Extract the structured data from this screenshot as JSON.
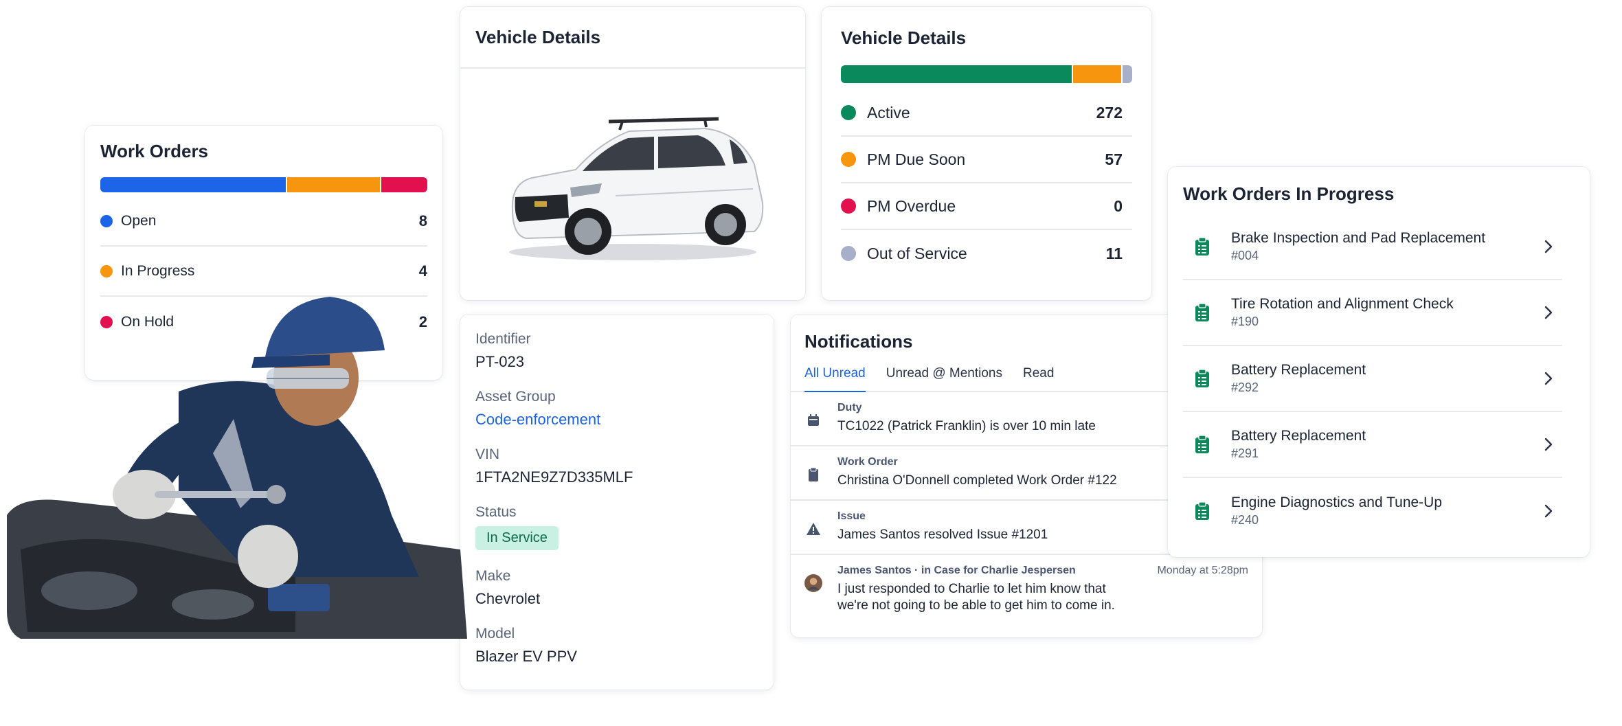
{
  "work_orders": {
    "title": "Work Orders",
    "bar": [
      {
        "value": 8,
        "color": "#1c64e8"
      },
      {
        "value": 4,
        "color": "#f7950f"
      },
      {
        "value": 2,
        "color": "#e2104f"
      }
    ],
    "items": [
      {
        "label": "Open",
        "count": "8",
        "color": "#1c64e8"
      },
      {
        "label": "In Progress",
        "count": "4",
        "color": "#f7950f"
      },
      {
        "label": "On Hold",
        "count": "2",
        "color": "#e2104f"
      }
    ]
  },
  "vehicle_photo": {
    "title": "Vehicle Details"
  },
  "vehicle_stats": {
    "title": "Vehicle Details",
    "bar": [
      {
        "value": 272,
        "color": "#0a8a5c"
      },
      {
        "value": 57,
        "color": "#f7950f"
      },
      {
        "value": 0,
        "color": "#e2104f"
      },
      {
        "value": 11,
        "color": "#a7b0c8"
      }
    ],
    "items": [
      {
        "label": "Active",
        "count": "272",
        "color": "#0a8a5c"
      },
      {
        "label": "PM Due Soon",
        "count": "57",
        "color": "#f7950f"
      },
      {
        "label": "PM Overdue",
        "count": "0",
        "color": "#e2104f"
      },
      {
        "label": "Out of Service",
        "count": "11",
        "color": "#a7b0c8"
      }
    ]
  },
  "details": {
    "identifier_label": "Identifier",
    "identifier": "PT-023",
    "asset_group_label": "Asset Group",
    "asset_group": "Code-enforcement",
    "vin_label": "VIN",
    "vin": "1FTA2NE9Z7D335MLF",
    "status_label": "Status",
    "status": "In Service",
    "make_label": "Make",
    "make": "Chevrolet",
    "model_label": "Model",
    "model": "Blazer EV PPV"
  },
  "notifications": {
    "title": "Notifications",
    "tabs": [
      "All Unread",
      "Unread @ Mentions",
      "Read"
    ],
    "items": [
      {
        "icon": "calendar-icon",
        "category": "Duty",
        "text": "TC1022 (Patrick Franklin) is over 10 min late",
        "time": "Mo"
      },
      {
        "icon": "clipboard-icon",
        "category": "Work Order",
        "text": "Christina O'Donnell completed Work Order #122",
        "time": "M"
      },
      {
        "icon": "warning-icon",
        "category": "Issue",
        "text": "James Santos resolved Issue #1201",
        "time": "M"
      },
      {
        "icon": "avatar",
        "category": "James Santos · in Case for Charlie Jespersen",
        "text": "I just responded to Charlie to let him know that we're not going to be able to get him to come in.",
        "time": "Monday at 5:28pm"
      }
    ]
  },
  "in_progress": {
    "title": "Work Orders In Progress",
    "icon_color": "#0a8a5c",
    "items": [
      {
        "name": "Brake Inspection and Pad Replacement",
        "number": "#004"
      },
      {
        "name": "Tire Rotation and Alignment Check",
        "number": "#190"
      },
      {
        "name": "Battery Replacement",
        "number": "#292"
      },
      {
        "name": "Battery Replacement",
        "number": "#291"
      },
      {
        "name": "Engine Diagnostics and Tune-Up",
        "number": "#240"
      }
    ]
  }
}
